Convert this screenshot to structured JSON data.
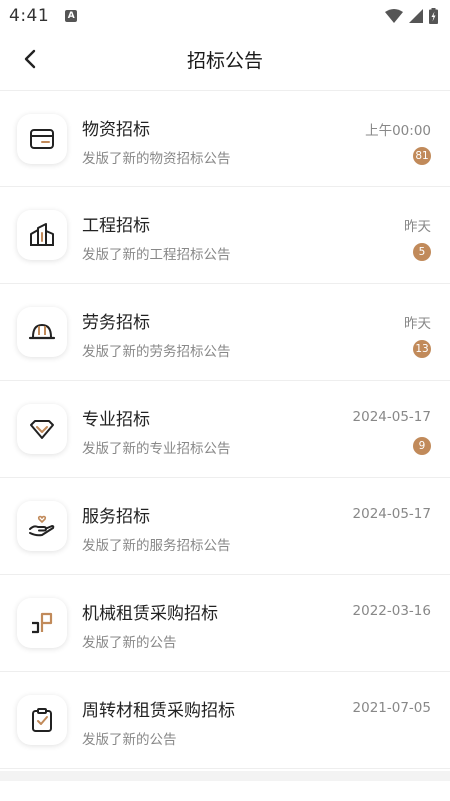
{
  "status_bar": {
    "time": "4:41",
    "badge": "A"
  },
  "header": {
    "title": "招标公告"
  },
  "colors": {
    "accent": "#c18a5a",
    "icon_dark": "#222222"
  },
  "items": [
    {
      "icon": "package-icon",
      "title": "物资招标",
      "subtitle": "发版了新的物资招标公告",
      "time": "上午00:00",
      "count": "81"
    },
    {
      "icon": "buildings-icon",
      "title": "工程招标",
      "subtitle": "发版了新的工程招标公告",
      "time": "昨天",
      "count": "5"
    },
    {
      "icon": "hardhat-icon",
      "title": "劳务招标",
      "subtitle": "发版了新的劳务招标公告",
      "time": "昨天",
      "count": "13"
    },
    {
      "icon": "diamond-icon",
      "title": "专业招标",
      "subtitle": "发版了新的专业招标公告",
      "time": "2024-05-17",
      "count": "9"
    },
    {
      "icon": "hand-heart-icon",
      "title": "服务招标",
      "subtitle": "发版了新的服务招标公告",
      "time": "2024-05-17",
      "count": ""
    },
    {
      "icon": "machine-icon",
      "title": "机械租赁采购招标",
      "subtitle": "发版了新的公告",
      "time": "2022-03-16",
      "count": ""
    },
    {
      "icon": "clipboard-check-icon",
      "title": "周转材租赁采购招标",
      "subtitle": "发版了新的公告",
      "time": "2021-07-05",
      "count": ""
    }
  ]
}
